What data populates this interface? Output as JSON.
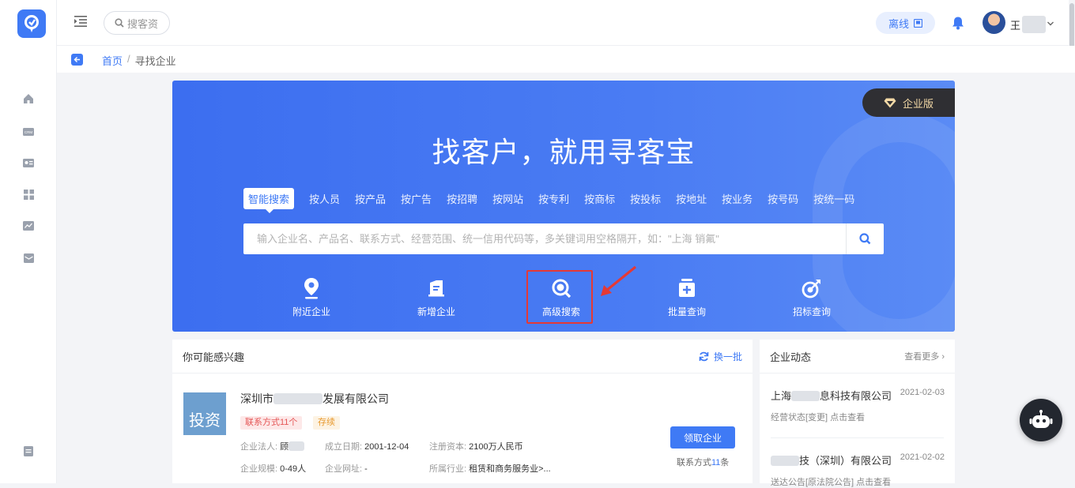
{
  "topbar": {
    "search_placeholder": "搜客资",
    "offline_label": "离线",
    "user_name": "王"
  },
  "breadcrumb": {
    "home": "首页",
    "separator": "/",
    "current": "寻找企业"
  },
  "hero": {
    "title": "找客户，就用寻客宝",
    "badge": "企业版",
    "tabs": [
      "智能搜索",
      "按人员",
      "按产品",
      "按广告",
      "按招聘",
      "按网站",
      "按专利",
      "按商标",
      "按投标",
      "按地址",
      "按业务",
      "按号码",
      "按统一码"
    ],
    "search_placeholder": "输入企业名、产品名、联系方式、经营范围、统一信用代码等，多关键词用空格隔开，如：\"上海 销氟\"",
    "quick_links": [
      "附近企业",
      "新增企业",
      "高级搜索",
      "批量查询",
      "招标查询"
    ]
  },
  "recommend": {
    "title": "你可能感兴趣",
    "refresh_label": "换一批",
    "company": {
      "logo_text": "投资",
      "name_prefix": "深圳市",
      "name_suffix": "发展有限公司",
      "tag_contact": "联系方式11个",
      "tag_status": "存续",
      "legal_label": "企业法人:",
      "legal_value": "顾",
      "founded_label": "成立日期:",
      "founded_value": "2001-12-04",
      "capital_label": "注册资本:",
      "capital_value": "2100万人民币",
      "scale_label": "企业规模:",
      "scale_value": "0-49人",
      "website_label": "企业网址:",
      "website_value": "-",
      "industry_label": "所属行业:",
      "industry_value": "租赁和商务服务业>...",
      "claim_label": "领取企业",
      "contact_prefix": "联系方式",
      "contact_count": "11",
      "contact_suffix": "条"
    }
  },
  "news": {
    "title": "企业动态",
    "more_label": "查看更多",
    "items": [
      {
        "name_prefix": "上海",
        "name_suffix": "息科技有限公司",
        "date": "2021-02-03",
        "sub": "经营状态[变更] 点击查看"
      },
      {
        "name_prefix": "",
        "name_suffix": "技（深圳）有限公司",
        "date": "2021-02-02",
        "sub": "送达公告[原法院公告] 点击查看"
      }
    ]
  },
  "colors": {
    "primary": "#3f7af5",
    "highlight_border": "#e53935",
    "badge_bg": "#2f2f33",
    "badge_text": "#f3d9a6"
  }
}
